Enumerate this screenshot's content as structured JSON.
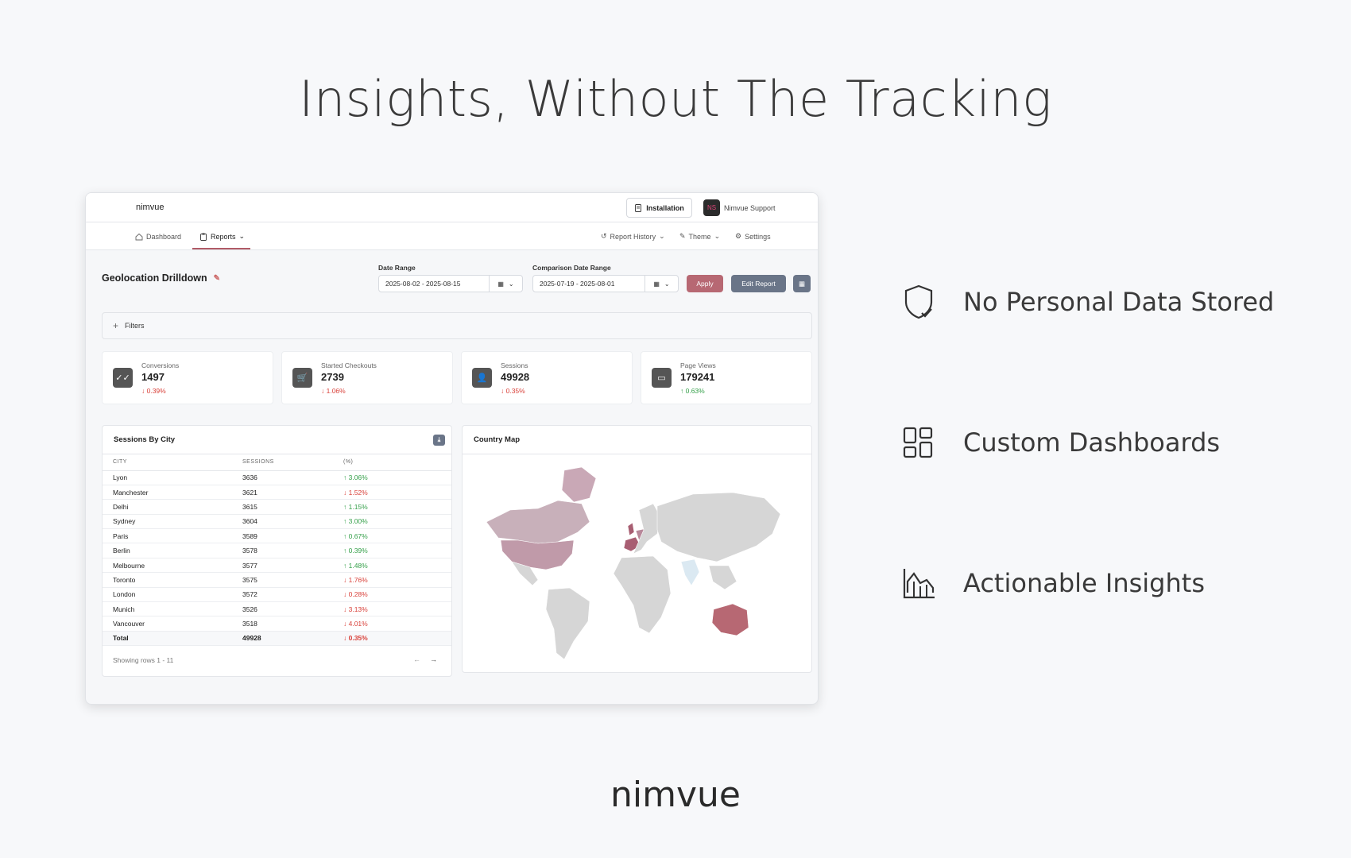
{
  "hero": {
    "title": "Insights, Without The Tracking"
  },
  "app": {
    "brand": "nimvue",
    "topbar": {
      "install_label": "Installation",
      "support_avatar": "NS",
      "support_label": "Nimvue Support"
    },
    "nav": {
      "dashboard": "Dashboard",
      "reports": "Reports",
      "report_history": "Report History",
      "theme": "Theme",
      "settings": "Settings"
    },
    "page_title": "Geolocation Drilldown",
    "date_range": {
      "label": "Date Range",
      "value": "2025-08-02 - 2025-08-15"
    },
    "comparison_range": {
      "label": "Comparison Date Range",
      "value": "2025-07-19 - 2025-08-01"
    },
    "buttons": {
      "apply": "Apply",
      "edit_report": "Edit Report"
    },
    "filters_label": "Filters",
    "kpis": [
      {
        "label": "Conversions",
        "value": "1497",
        "change": "↓ 0.39%",
        "trend": "neg",
        "icon": "double-check-icon"
      },
      {
        "label": "Started Checkouts",
        "value": "2739",
        "change": "↓ 1.06%",
        "trend": "neg",
        "icon": "cart-icon"
      },
      {
        "label": "Sessions",
        "value": "49928",
        "change": "↓ 0.35%",
        "trend": "neg",
        "icon": "user-icon"
      },
      {
        "label": "Page Views",
        "value": "179241",
        "change": "↑ 0.63%",
        "trend": "pos",
        "icon": "pages-icon"
      }
    ],
    "sessions_table": {
      "title": "Sessions By City",
      "columns": [
        "CITY",
        "SESSIONS",
        "(%)"
      ],
      "rows": [
        {
          "city": "Lyon",
          "sessions": "3636",
          "pct": "↑ 3.06%",
          "trend": "pos"
        },
        {
          "city": "Manchester",
          "sessions": "3621",
          "pct": "↓ 1.52%",
          "trend": "neg"
        },
        {
          "city": "Delhi",
          "sessions": "3615",
          "pct": "↑ 1.15%",
          "trend": "pos"
        },
        {
          "city": "Sydney",
          "sessions": "3604",
          "pct": "↑ 3.00%",
          "trend": "pos"
        },
        {
          "city": "Paris",
          "sessions": "3589",
          "pct": "↑ 0.67%",
          "trend": "pos"
        },
        {
          "city": "Berlin",
          "sessions": "3578",
          "pct": "↑ 0.39%",
          "trend": "pos"
        },
        {
          "city": "Melbourne",
          "sessions": "3577",
          "pct": "↑ 1.48%",
          "trend": "pos"
        },
        {
          "city": "Toronto",
          "sessions": "3575",
          "pct": "↓ 1.76%",
          "trend": "neg"
        },
        {
          "city": "London",
          "sessions": "3572",
          "pct": "↓ 0.28%",
          "trend": "neg"
        },
        {
          "city": "Munich",
          "sessions": "3526",
          "pct": "↓ 3.13%",
          "trend": "neg"
        },
        {
          "city": "Vancouver",
          "sessions": "3518",
          "pct": "↓ 4.01%",
          "trend": "neg"
        }
      ],
      "total": {
        "city": "Total",
        "sessions": "49928",
        "pct": "↓ 0.35%",
        "trend": "neg"
      },
      "showing": "Showing rows 1 - 11"
    },
    "map": {
      "title": "Country Map"
    }
  },
  "features": [
    {
      "label": "No Personal Data Stored",
      "icon": "shield-check-icon"
    },
    {
      "label": "Custom Dashboards",
      "icon": "dashboard-layout-icon"
    },
    {
      "label": "Actionable Insights",
      "icon": "area-chart-icon"
    }
  ],
  "footer_brand": "nimvue",
  "colors": {
    "accent": "#b76873",
    "secondary": "#6a7588",
    "positive": "#35a04a",
    "negative": "#d9413a"
  }
}
